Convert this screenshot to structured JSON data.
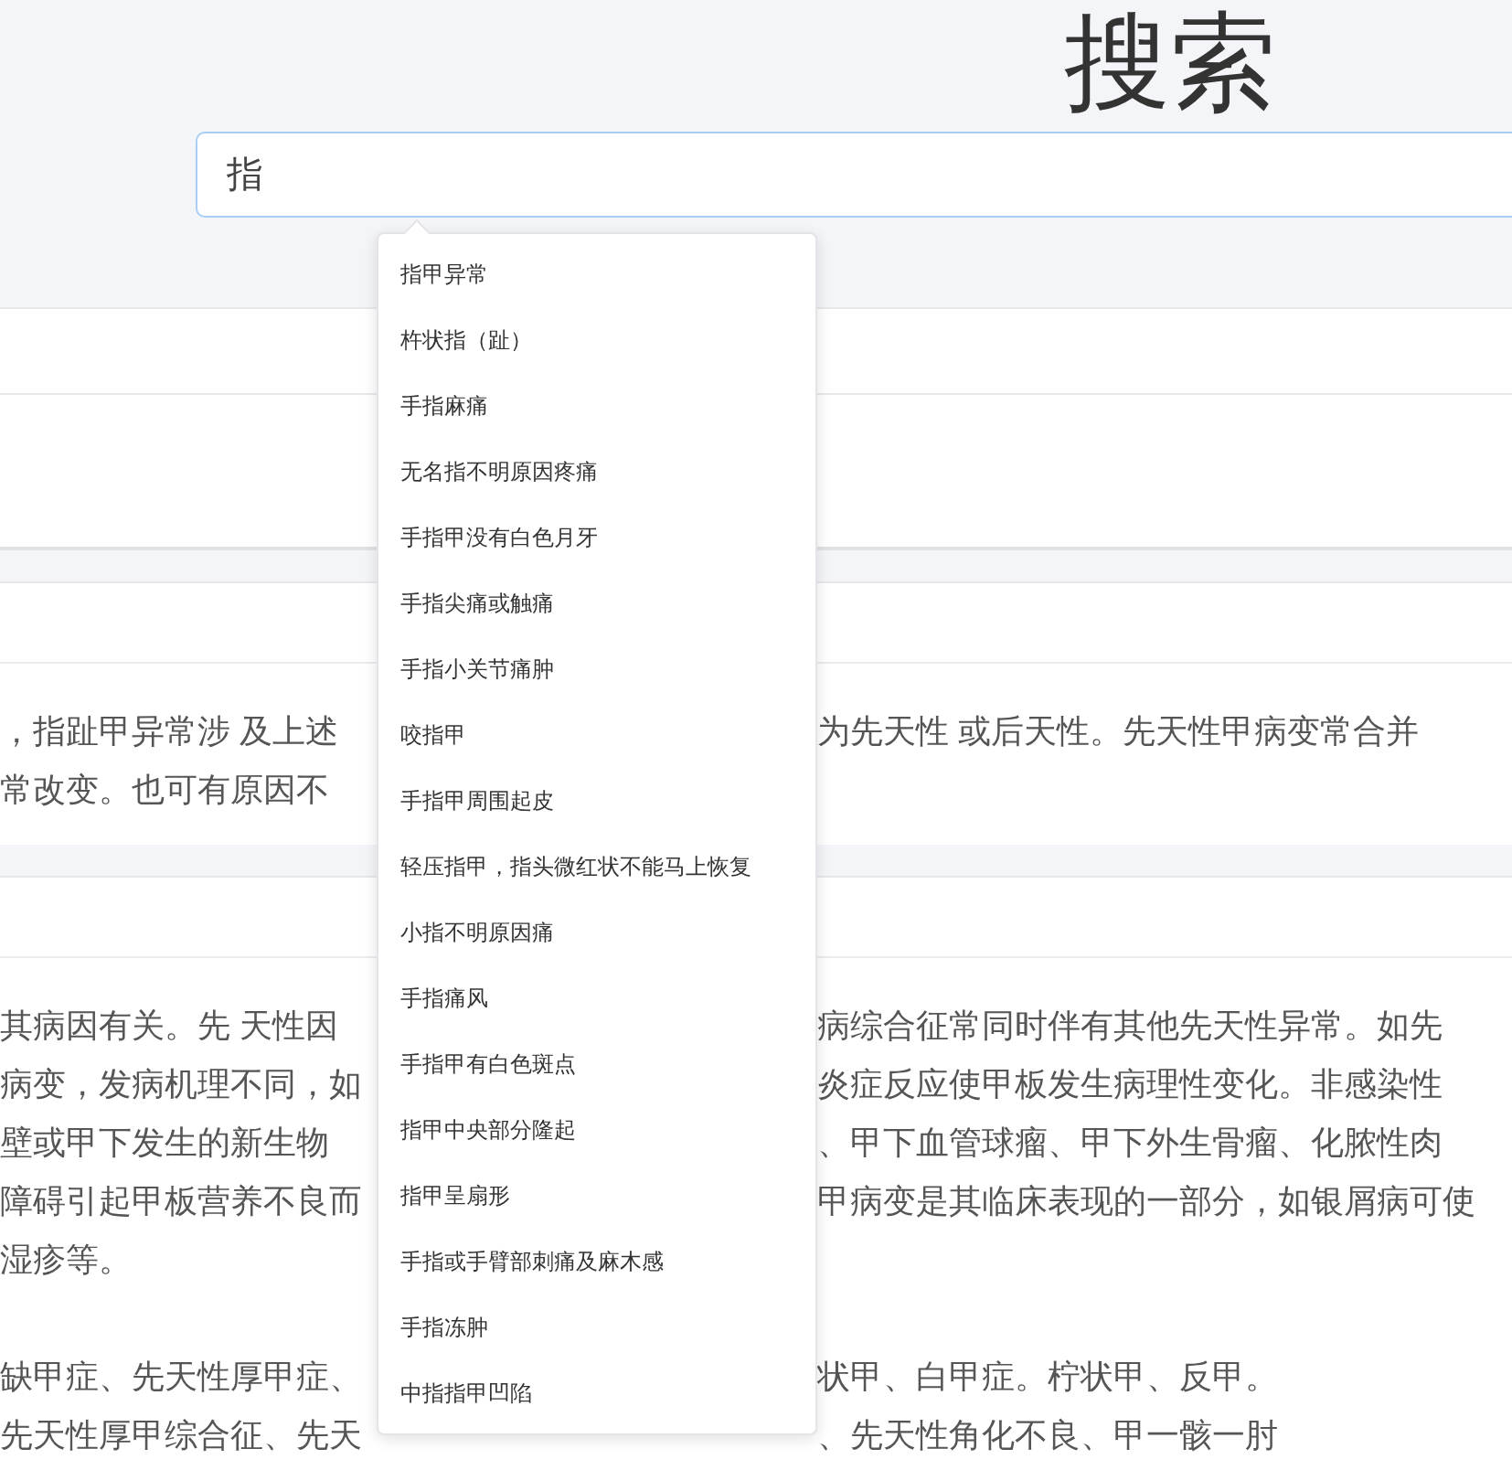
{
  "title": "搜索",
  "search": {
    "value": "指"
  },
  "suggestions": [
    {
      "label": "指甲异常"
    },
    {
      "label": "杵状指（趾）"
    },
    {
      "label": "手指麻痛"
    },
    {
      "label": "无名指不明原因疼痛"
    },
    {
      "label": "手指甲没有白色月牙"
    },
    {
      "label": "手指尖痛或触痛"
    },
    {
      "label": "手指小关节痛肿"
    },
    {
      "label": "咬指甲"
    },
    {
      "label": "手指甲周围起皮"
    },
    {
      "label": "轻压指甲，指头微红状不能马上恢复"
    },
    {
      "label": "小指不明原因痛"
    },
    {
      "label": "手指痛风"
    },
    {
      "label": "手指甲有白色斑点"
    },
    {
      "label": "指甲中央部分隆起"
    },
    {
      "label": "指甲呈扇形"
    },
    {
      "label": "手指或手臂部刺痛及麻木感"
    },
    {
      "label": "手指冻肿"
    },
    {
      "label": "中指指甲凹陷"
    }
  ],
  "cards": [
    {
      "paragraphs": [
        [
          {
            "left": "，指趾甲异常涉 及上述",
            "right": "为先天性 或后天性。先天性甲病变常合并"
          },
          {
            "left": "常改变。也可有原因不"
          }
        ]
      ]
    },
    {
      "paragraphs": [
        [
          {
            "left": "其病因有关。先 天性因",
            "right": "病综合征常同时伴有其他先天性异常。如先"
          },
          {
            "left": "病变，发病机理不同，如",
            "right": "炎症反应使甲板发生病理性变化。非感染性"
          },
          {
            "left": "壁或甲下发生的新生物",
            "right": "、甲下血管球瘤、甲下外生骨瘤、化脓性肉"
          },
          {
            "left": "障碍引起甲板营养不良而",
            "right": "甲病变是其临床表现的一部分，如银屑病可使"
          },
          {
            "left": "湿疹等。"
          }
        ],
        [
          {
            "left": "缺甲症、先天性厚甲症、",
            "right": "状甲、白甲症。柠状甲、反甲。"
          },
          {
            "left": "先天性厚甲综合征、先天",
            "right": "、先天性角化不良、甲一骸一肘"
          }
        ]
      ]
    }
  ]
}
